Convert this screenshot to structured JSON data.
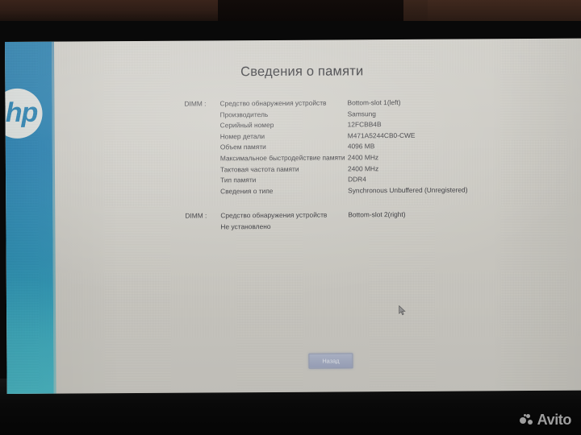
{
  "screen": {
    "title": "Сведения о памяти",
    "brand_logo": "hp",
    "dimm_sections": [
      {
        "key": "DIMM :",
        "rows": [
          {
            "label": "Средство обнаружения устройств",
            "value": "Bottom-slot 1(left)"
          },
          {
            "label": "Производитель",
            "value": "Samsung"
          },
          {
            "label": "Серийный номер",
            "value": "12FCBB4B"
          },
          {
            "label": "Номер детали",
            "value": "M471A5244CB0-CWE"
          },
          {
            "label": "Объем памяти",
            "value": "4096 MB"
          },
          {
            "label": "Максимальное быстродействие памяти",
            "value": "2400 MHz"
          },
          {
            "label": "Тактовая частота памяти",
            "value": "2400 MHz"
          },
          {
            "label": "Тип памяти",
            "value": "DDR4"
          },
          {
            "label": "Сведения о типе",
            "value": "Synchronous  Unbuffered (Unregistered)"
          }
        ]
      },
      {
        "key": "DIMM :",
        "rows": [
          {
            "label": "Средство обнаружения устройств",
            "value": "Bottom-slot 2(right)"
          },
          {
            "label": "Не установлено",
            "value": ""
          }
        ]
      }
    ],
    "back_button": "Назад"
  },
  "watermark": {
    "text": "Avito"
  },
  "colors": {
    "hp_blue": "#1b7cb0",
    "hp_teal": "#4cbcc9",
    "screen_bg": "#cfcdc6",
    "text": "#2e2e33",
    "button_bg": "#a9b1c7"
  }
}
